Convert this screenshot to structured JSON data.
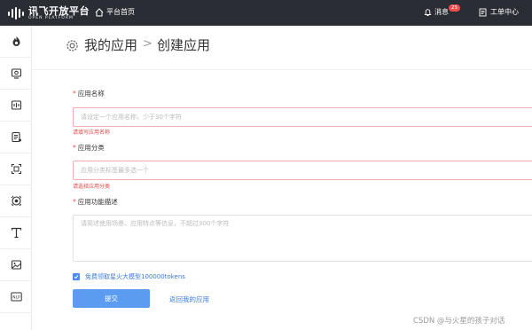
{
  "topbar": {
    "logo_text": "讯飞开放平台",
    "logo_sub": "OPEN PLATFORM",
    "home_label": "平台首页",
    "messages_label": "消息",
    "messages_badge": "25",
    "ticket_label": "工单中心"
  },
  "sidebar": {
    "items": [
      {
        "icon": "flame-icon"
      },
      {
        "icon": "app-icon"
      },
      {
        "icon": "voice-icon"
      },
      {
        "icon": "doc-icon"
      },
      {
        "icon": "scan-icon"
      },
      {
        "icon": "face-icon"
      },
      {
        "icon": "text-icon"
      },
      {
        "icon": "image-icon"
      },
      {
        "icon": "nlp-icon"
      }
    ],
    "nlp_label": "NLP"
  },
  "header": {
    "title": "我的应用",
    "separator": ">",
    "subtitle": "创建应用"
  },
  "form": {
    "required_mark": "*",
    "name_label": "应用名称",
    "name_placeholder": "请设定一个应用名称，少于30个字符",
    "name_error": "请填写应用名称",
    "category_label": "应用分类",
    "category_placeholder": "应用分类标签最多选一个",
    "category_error": "请选择应用分类",
    "desc_label": "应用功能描述",
    "desc_placeholder": "请简述使用场景、应用特点等信息，不超过300个字符",
    "agree_text": "免费领取星火大模型100000tokens",
    "submit_label": "提交",
    "back_label": "返回我的应用"
  },
  "watermark": "CSDN @与火星的孩子对话",
  "colors": {
    "topbar": "#2a2d33",
    "primary": "#5b9cf0",
    "link": "#3a7bd5",
    "error": "#e24646",
    "badge": "#ee4d4d"
  }
}
